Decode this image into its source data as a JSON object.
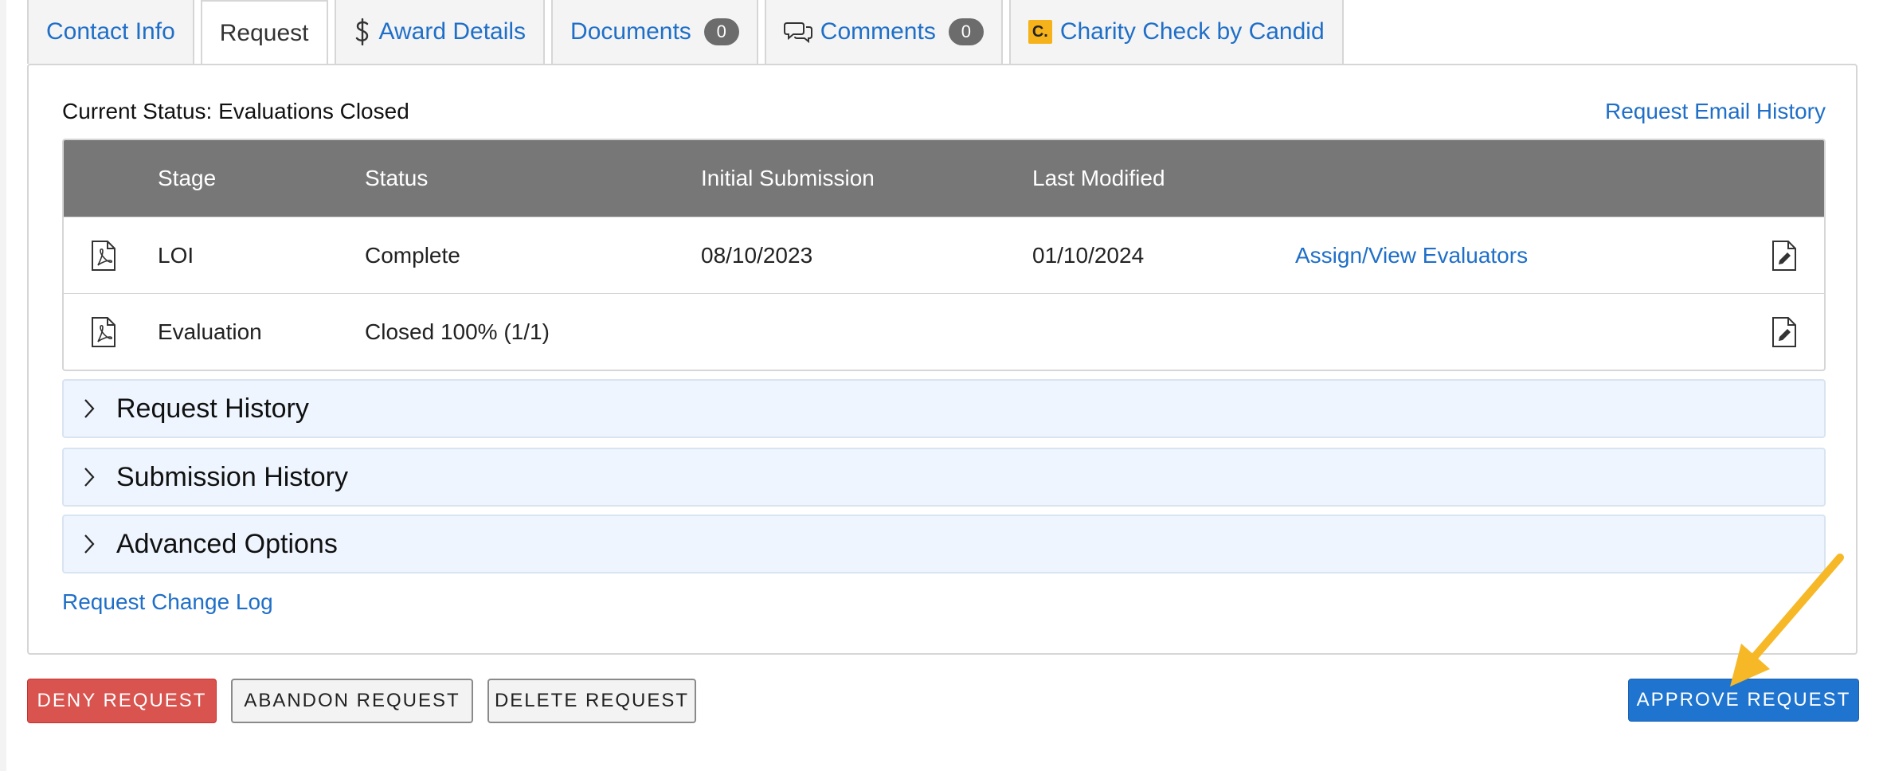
{
  "tabs": [
    {
      "label": "Contact Info",
      "icon": ""
    },
    {
      "label": "Request",
      "icon": ""
    },
    {
      "label": "Award Details",
      "icon": "dollar-icon"
    },
    {
      "label": "Documents",
      "icon": "",
      "badge": "0"
    },
    {
      "label": "Comments",
      "icon": "comments-icon",
      "badge": "0"
    },
    {
      "label": "Charity Check by Candid",
      "icon": "candid-logo",
      "logo_text": "C."
    }
  ],
  "active_tab": "Request",
  "status_line": "Current Status: Evaluations Closed",
  "email_history_link": "Request Email History",
  "table": {
    "headers": [
      "Stage",
      "Status",
      "Initial Submission",
      "Last Modified"
    ],
    "rows": [
      {
        "stage": "LOI",
        "status": "Complete",
        "initial_submission": "08/10/2023",
        "last_modified": "01/10/2024",
        "action": "Assign/View Evaluators"
      },
      {
        "stage": "Evaluation",
        "status": "Closed 100% (1/1)",
        "initial_submission": "",
        "last_modified": "",
        "action": ""
      }
    ]
  },
  "accordions": [
    "Request History",
    "Submission History",
    "Advanced Options"
  ],
  "change_log_link": "Request Change Log",
  "buttons": {
    "deny": "DENY REQUEST",
    "abandon": "ABANDON REQUEST",
    "delete": "DELETE REQUEST",
    "approve": "APPROVE REQUEST"
  },
  "colors": {
    "link": "#1f6fc8",
    "deny": "#d9534f",
    "approve": "#1f74d0",
    "table_header": "#777777",
    "accordion_bg": "#eef5fe",
    "annotation_arrow": "#f6b826"
  }
}
